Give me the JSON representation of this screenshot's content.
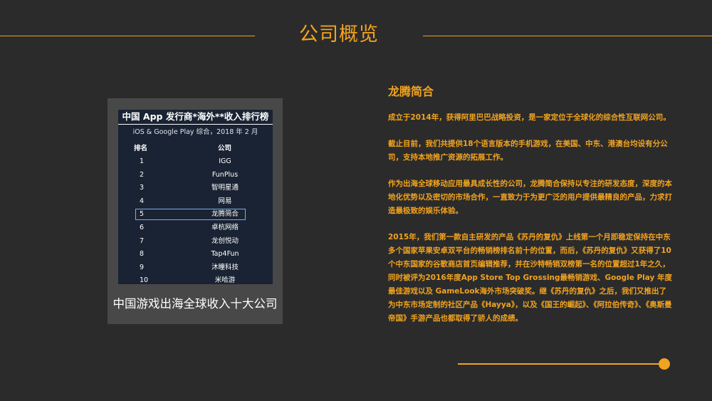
{
  "header": {
    "title": "公司概览"
  },
  "figure": {
    "chart_title": "中国 App 发行商*海外**收入排行榜",
    "chart_subtitle": "iOS & Google Play 综合，2018 年 2 月",
    "col_rank": "排名",
    "col_company": "公司",
    "rows": [
      {
        "rank": "1",
        "company": "IGG"
      },
      {
        "rank": "2",
        "company": "FunPlus"
      },
      {
        "rank": "3",
        "company": "智明星通"
      },
      {
        "rank": "4",
        "company": "网易"
      },
      {
        "rank": "5",
        "company": "龙腾简合"
      },
      {
        "rank": "6",
        "company": "卓杭网络"
      },
      {
        "rank": "7",
        "company": "龙创悦动"
      },
      {
        "rank": "8",
        "company": "Tap4Fun"
      },
      {
        "rank": "9",
        "company": "沐瞳科技"
      },
      {
        "rank": "10",
        "company": "米哈游"
      }
    ],
    "caption": "中国游戏出海全球收入十大公司"
  },
  "content": {
    "company_name": "龙腾简合",
    "paragraphs": [
      "成立于2014年，获得阿里巴巴战略投资，是一家定位于全球化的综合性互联网公司。",
      "截止目前，我们共提供18个语言版本的手机游戏，在美国、中东、港澳台均设有分公司，支持本地推广资源的拓展工作。",
      "作为出海全球移动应用最具成长性的公司，龙腾简合保持以专注的研发态度，深度的本地化优势以及密切的市场合作，一直致力于为更广泛的用户提供最精良的产品，力求打造最极致的娱乐体验。",
      "2015年，我们第一款自主研发的产品《苏丹的复仇》上线第一个月即稳定保持在中东多个国家苹果安卓双平台的畅销榜排名前十的位置，而后，《苏丹的复仇》又获得了10个中东国家的谷歌商店首页编辑推荐，并在沙特畅销双榜第一名的位置超过1年之久，同时被评为2016年度App Store Top Grossing最畅销游戏、Google Play 年度最佳游戏以及 GameLook海外市场突破奖。继《苏丹的复仇》之后，我们又推出了为中东市场定制的社区产品《Hayya》，以及《国王的崛起》、《阿拉伯传奇》、《奥斯曼帝国》手游产品也都取得了骄人的成绩。"
    ]
  },
  "colors": {
    "accent": "#f2a31f",
    "background": "#2b2b2b",
    "panel": "#1a2333",
    "card": "#484848"
  }
}
